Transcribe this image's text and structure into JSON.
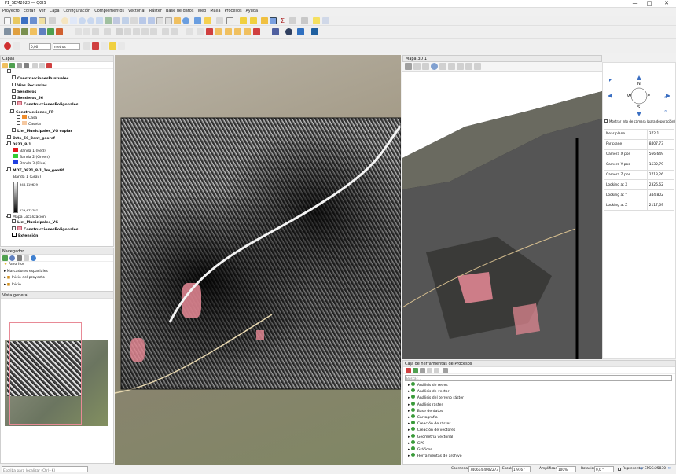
{
  "window": {
    "title": "P1_SEM2020 — QGIS",
    "controls": [
      "—",
      "□",
      "✕"
    ]
  },
  "menu": [
    "Proyecto",
    "Editar",
    "Ver",
    "Capa",
    "Configuración",
    "Complementos",
    "Vectorial",
    "Ráster",
    "Base de datos",
    "Web",
    "Malla",
    "Procesos",
    "Ayuda"
  ],
  "toolbar": {
    "buffer_value": "0,00",
    "units": "metros"
  },
  "layers_panel": {
    "title": "Capas",
    "items": [
      {
        "label": "ConstruccionesPuntuales",
        "bold": true,
        "indent": 2
      },
      {
        "label": "Vias Pecuarias",
        "bold": true,
        "indent": 2
      },
      {
        "label": "Senderos",
        "bold": true,
        "indent": 2
      },
      {
        "label": "Senderos_56",
        "bold": true,
        "indent": 2
      },
      {
        "label": "ConstruccionesPoligonales",
        "bold": true,
        "indent": 2,
        "swatch": "#f2a0b0"
      },
      {
        "label": "Construcciones_FP",
        "bold": true,
        "indent": 2
      },
      {
        "label": "Casa",
        "bold": false,
        "indent": 3,
        "swatch": "#ef8c2a"
      },
      {
        "label": "Caseta",
        "bold": false,
        "indent": 3,
        "swatch": "#f5c8a0"
      },
      {
        "label": "Lim_Municipales_VG copiar",
        "bold": true,
        "indent": 2
      },
      {
        "label": "Orto_56_Bent_georef",
        "bold": true,
        "indent": 1
      },
      {
        "label": "0821_8-1",
        "bold": true,
        "indent": 1
      },
      {
        "label": "Banda 1 (Red)",
        "bold": false,
        "indent": 2,
        "swatch": "#e31a1c"
      },
      {
        "label": "Banda 2 (Green)",
        "bold": false,
        "indent": 2,
        "swatch": "#33cc33"
      },
      {
        "label": "Banda 3 (Blue)",
        "bold": false,
        "indent": 2,
        "swatch": "#1f3fe0"
      },
      {
        "label": "MDT_0821_8-1_1m_geotif",
        "bold": true,
        "indent": 1
      },
      {
        "label": "Banda 1 (Gray)",
        "bold": false,
        "indent": 2
      }
    ],
    "gray_max": "946,119629",
    "gray_min": "229,672797",
    "items2": [
      {
        "label": "Mapa Localización",
        "bold": false,
        "indent": 1
      },
      {
        "label": "Lim_Municipales_VG",
        "bold": true,
        "indent": 2
      },
      {
        "label": "ConstruccionesPoligonales",
        "bold": true,
        "indent": 2,
        "swatch": "#f2a0b0"
      },
      {
        "label": "Extensión",
        "bold": true,
        "indent": 2,
        "swatch": "#ffffff"
      }
    ]
  },
  "navigator": {
    "title": "Navegador",
    "items": [
      "Favoritos",
      "Marcadores espaciales",
      "Inicio del proyecto",
      "Inicio"
    ]
  },
  "overview": {
    "title": "Vista general"
  },
  "map3d": {
    "title": "Mapa 3D 1",
    "show_camera_label": "Mostrar info de cámara (para depuración)",
    "camera": [
      {
        "label": "Near plane",
        "value": "372,1"
      },
      {
        "label": "Far plane",
        "value": "8407,73"
      },
      {
        "label": "Camera X pos",
        "value": "566,649"
      },
      {
        "label": "Camera Y pos",
        "value": "1532,79"
      },
      {
        "label": "Camera Z pos",
        "value": "2713,26"
      },
      {
        "label": "Looking at X",
        "value": "2326,62"
      },
      {
        "label": "Looking at Y",
        "value": "344,802"
      },
      {
        "label": "Looking at Z",
        "value": "2117,69"
      }
    ],
    "compass": {
      "n": "N",
      "e": "E",
      "s": "S",
      "w": "W"
    }
  },
  "processing": {
    "title": "Caja de herramientas de Procesos",
    "search_placeholder": "Buscar...",
    "items": [
      "Análisis de redes",
      "Análisis de vector",
      "Análisis del terreno ráster",
      "Análisis ráster",
      "Base de datos",
      "Cartografía",
      "Creación de ráster",
      "Creación de vectores",
      "Geometría vectorial",
      "GPS",
      "Gráficos",
      "Herramientas de archivo"
    ]
  },
  "status": {
    "locator_placeholder": "Escriba para localizar (Ctrl+K)",
    "coord_label": "Coordenada",
    "coord_value": "740614,4002273",
    "scale_label": "Escala",
    "scale_value": "1:9167",
    "magnifier_label": "Amplificador",
    "magnifier_value": "100%",
    "rotation_label": "Rotación",
    "rotation_value": "0,0 °",
    "render_label": "Representar",
    "crs": "EPSG:25830"
  },
  "colors": {
    "accent": "#3b6fc2",
    "pink": "#e88a96"
  }
}
